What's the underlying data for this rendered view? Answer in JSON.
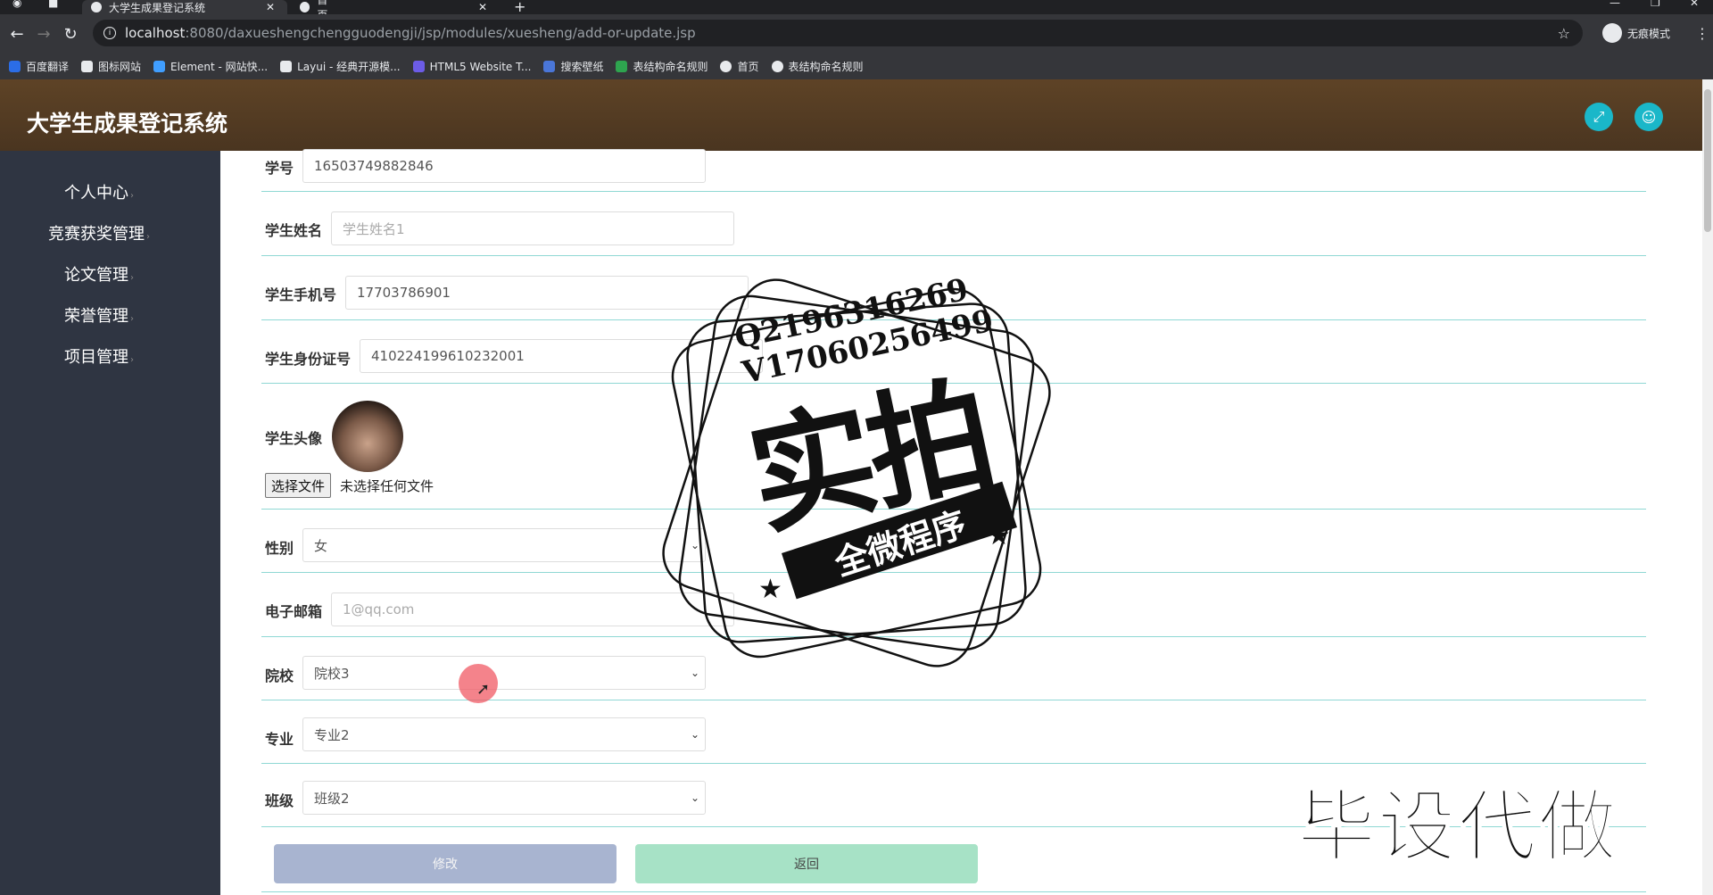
{
  "browser": {
    "tabs": [
      {
        "title": "大学生成果登记系统",
        "active": true
      },
      {
        "title": "首页",
        "active": false
      }
    ],
    "url_host": "localhost",
    "url_path": ":8080/daxueshengchengguodengji/jsp/modules/xuesheng/add-or-update.jsp",
    "incognito_label": "无痕模式",
    "bookmarks": [
      {
        "label": "百度翻译",
        "color": "#2b6de6"
      },
      {
        "label": "图标网站",
        "color": "#e8eaed"
      },
      {
        "label": "Element - 网站快...",
        "color": "#409eff"
      },
      {
        "label": "Layui - 经典开源模...",
        "color": "#e8eaed"
      },
      {
        "label": "HTML5 Website T...",
        "color": "#6c5ce7"
      },
      {
        "label": "搜索壁纸",
        "color": "#4a76d8"
      },
      {
        "label": "表结构命名规则",
        "color": "#2ea44f"
      },
      {
        "label": "首页",
        "color": "#e8eaed"
      },
      {
        "label": "表结构命名规则",
        "color": "#e8eaed"
      }
    ]
  },
  "app": {
    "title": "大学生成果登记系统",
    "header_color": "#5e4326",
    "accent_color": "#1ab7c9"
  },
  "sidebar": {
    "items": [
      {
        "label": "个人中心"
      },
      {
        "label": "竞赛获奖管理"
      },
      {
        "label": "论文管理"
      },
      {
        "label": "荣誉管理"
      },
      {
        "label": "项目管理"
      }
    ]
  },
  "form": {
    "xuehao": {
      "label": "学号",
      "value": "16503749882846"
    },
    "name": {
      "label": "学生姓名",
      "placeholder": "学生姓名1"
    },
    "phone": {
      "label": "学生手机号",
      "value": "17703786901"
    },
    "idcard": {
      "label": "学生身份证号",
      "value": "410224199610232001"
    },
    "avatar": {
      "label": "学生头像",
      "file_button": "选择文件",
      "file_status": "未选择任何文件"
    },
    "gender": {
      "label": "性别",
      "value": "女"
    },
    "email": {
      "label": "电子邮箱",
      "placeholder": "1@qq.com"
    },
    "school": {
      "label": "院校",
      "value": "院校3"
    },
    "major": {
      "label": "专业",
      "value": "专业2"
    },
    "class": {
      "label": "班级",
      "value": "班级2"
    },
    "submit_label": "修改",
    "back_label": "返回"
  },
  "watermark": {
    "line1": "Q2196316269",
    "line2": "V17060256499",
    "big": "实拍",
    "ribbon": "全微程序",
    "corner": "毕设代做"
  }
}
